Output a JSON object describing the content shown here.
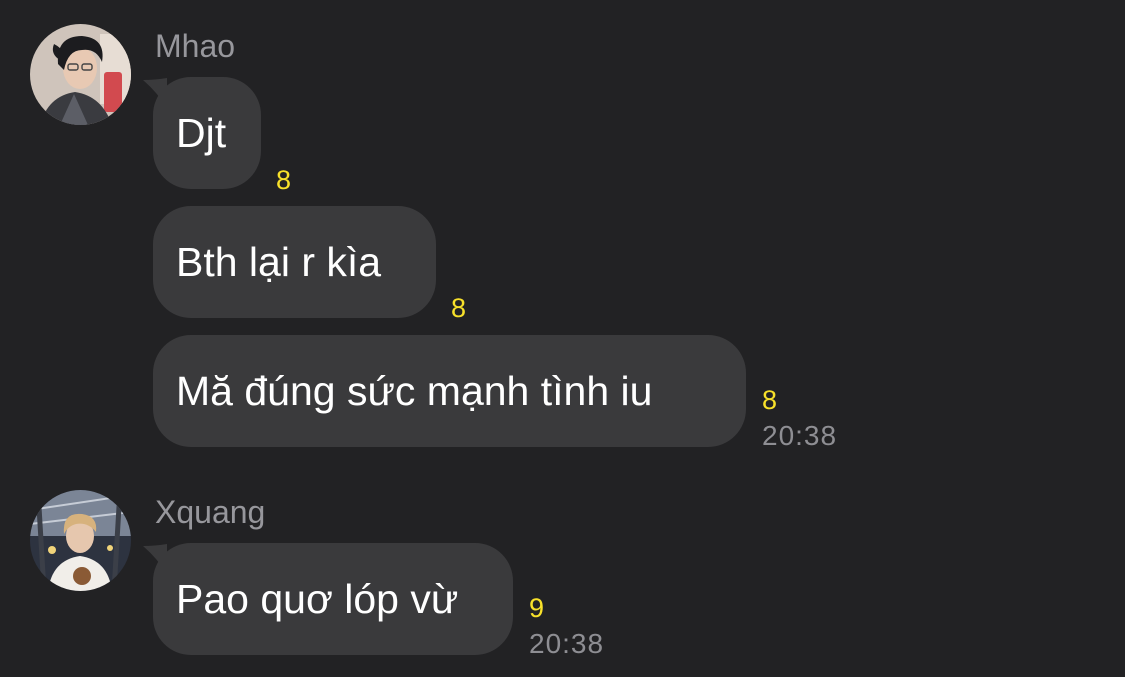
{
  "groups": [
    {
      "sender": "Mhao",
      "avatar_icon": "user-avatar-mhao",
      "messages": [
        {
          "text": "Djt",
          "reaction_count": "8",
          "time": ""
        },
        {
          "text": "Bth lại r kìa",
          "reaction_count": "8",
          "time": ""
        },
        {
          "text": "Mă đúng sức mạnh tình iu",
          "reaction_count": "8",
          "time": "20:38"
        }
      ]
    },
    {
      "sender": "Xquang",
      "avatar_icon": "user-avatar-xquang",
      "messages": [
        {
          "text": "Pao quơ lóp vừ",
          "reaction_count": "9",
          "time": "20:38"
        }
      ]
    }
  ],
  "colors": {
    "background": "#222224",
    "bubble": "#3a3a3c",
    "reaction_count": "#f8e12a",
    "secondary_text": "#8e8e93"
  }
}
